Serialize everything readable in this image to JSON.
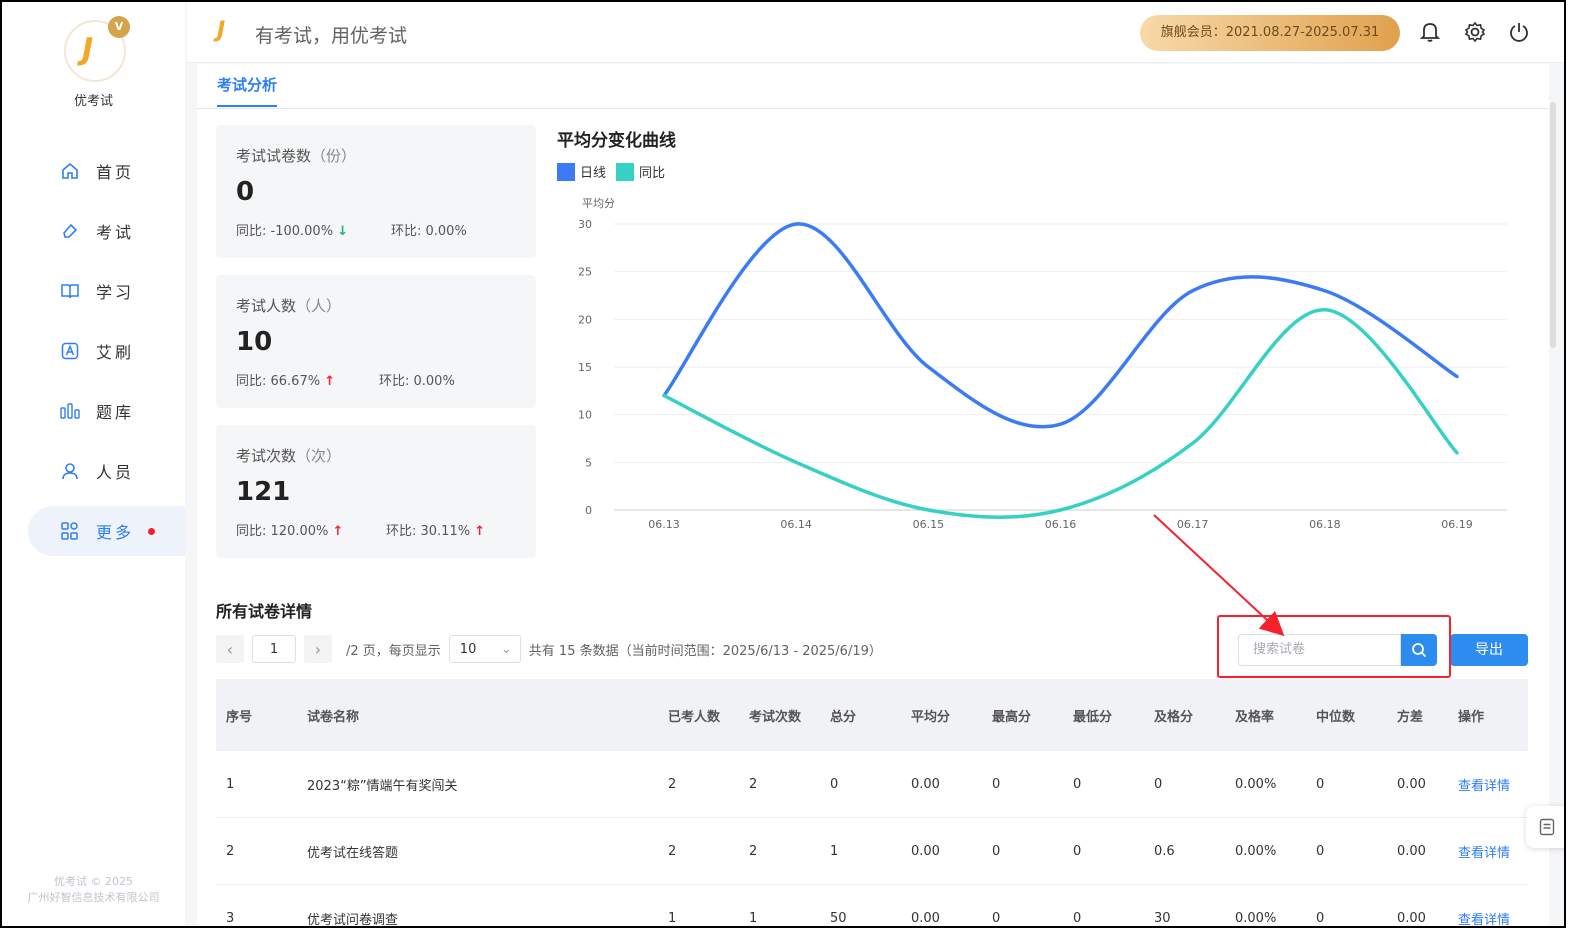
{
  "app": {
    "name": "优考试",
    "slogan": "有考试，用优考试",
    "vip_badge": "V"
  },
  "header": {
    "membership": "旗舰会员：2021.08.27-2025.07.31"
  },
  "sidebar": {
    "items": [
      {
        "label": "首页",
        "icon": "home-icon"
      },
      {
        "label": "考试",
        "icon": "eraser-icon"
      },
      {
        "label": "学习",
        "icon": "book-icon"
      },
      {
        "label": "艾刷",
        "icon": "a-box-icon"
      },
      {
        "label": "题库",
        "icon": "bars-icon"
      },
      {
        "label": "人员",
        "icon": "user-icon"
      },
      {
        "label": "更多",
        "icon": "grid-icon"
      }
    ],
    "copyright_1": "优考试 © 2025",
    "copyright_2": "广州好智信息技术有限公司"
  },
  "tabs": {
    "active": "考试分析"
  },
  "stats": [
    {
      "title": "考试试卷数",
      "unit": "（份）",
      "value": "0",
      "yoy": "同比: -100.00%",
      "mom": "环比: 0.00%"
    },
    {
      "title": "考试人数",
      "unit": "（人）",
      "value": "10",
      "yoy": "同比: 66.67%",
      "mom": "环比: 0.00%"
    },
    {
      "title": "考试次数",
      "unit": "（次）",
      "value": "121",
      "yoy": "同比: 120.00%",
      "mom": "环比: 30.11%"
    }
  ],
  "chart_data": {
    "type": "line",
    "title": "平均分变化曲线",
    "ylabel": "平均分",
    "categories": [
      "06.13",
      "06.14",
      "06.15",
      "06.16",
      "06.17",
      "06.18",
      "06.19"
    ],
    "series": [
      {
        "name": "日线",
        "color": "#3b7cf6",
        "values": [
          12,
          30,
          15,
          9,
          23,
          23,
          14
        ]
      },
      {
        "name": "同比",
        "color": "#36d1c4",
        "values": [
          12,
          5,
          0,
          0,
          7,
          21,
          6
        ]
      }
    ],
    "yticks": [
      0,
      5,
      10,
      15,
      20,
      25,
      30
    ],
    "ylim": [
      0,
      30
    ],
    "grid": true,
    "legend": "top-left"
  },
  "section": {
    "title": "所有试卷详情"
  },
  "pager": {
    "prev": "‹",
    "next": "›",
    "page": "1",
    "pages_text": "/2 页，每页显示",
    "page_size": "10",
    "total_text": "共有 15 条数据（当前时间范围：2025/6/13 - 2025/6/19）"
  },
  "search": {
    "placeholder": "搜索试卷"
  },
  "export_label": "导出",
  "table": {
    "headers": [
      "序号",
      "试卷名称",
      "已考人数",
      "考试次数",
      "总分",
      "平均分",
      "最高分",
      "最低分",
      "及格分",
      "及格率",
      "中位数",
      "方差",
      "操作"
    ],
    "rows": [
      [
        "1",
        "2023“粽”情端午有奖闯关",
        "2",
        "2",
        "0",
        "0.00",
        "0",
        "0",
        "0",
        "0.00%",
        "0",
        "0.00",
        "查看详情"
      ],
      [
        "2",
        "优考试在线答题",
        "2",
        "2",
        "1",
        "0.00",
        "0",
        "0",
        "0.6",
        "0.00%",
        "0",
        "0.00",
        "查看详情"
      ],
      [
        "3",
        "优考试问卷调查",
        "1",
        "1",
        "50",
        "0.00",
        "0",
        "0",
        "30",
        "0.00%",
        "0",
        "0.00",
        "查看详情"
      ]
    ]
  }
}
